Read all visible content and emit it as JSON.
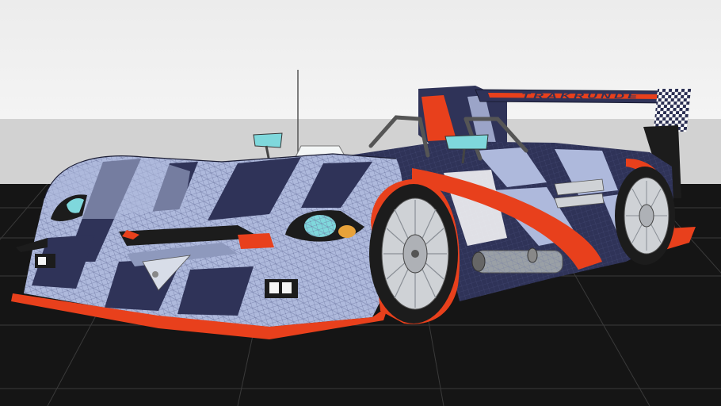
{
  "scene": {
    "subject": "race-car-wireframe-model",
    "wing_banner_text": "TRAKRUNDE",
    "colors": {
      "sky_top": "#ececec",
      "sky_bottom": "#f4f4f4",
      "horizon_band": "#d2d2d2",
      "ground": "#151515",
      "grid_line": "#3a3a3a",
      "body_light": "#aeb9dc",
      "body_dark": "#2f3358",
      "accent_red": "#e8401c",
      "tire": "#1c1c1c",
      "rim": "#cfd2d6",
      "exhaust": "#9aa0a6",
      "headlight_glass": "#7fd8dc",
      "indicator": "#e8a23a"
    }
  }
}
